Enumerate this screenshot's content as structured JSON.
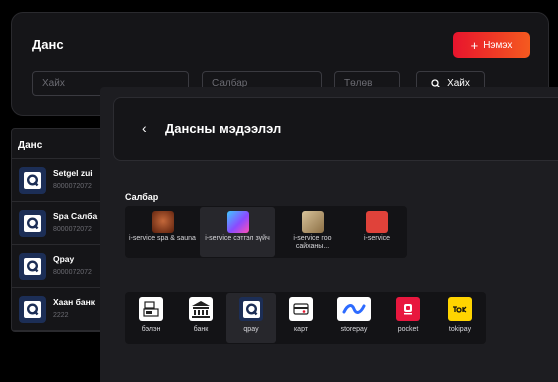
{
  "page": {
    "title": "Данс",
    "add_button": "Нэмэх",
    "search": {
      "placeholder": "Хайх"
    },
    "branch_select": {
      "placeholder": "Салбар"
    },
    "bank_select": {
      "placeholder": "Төлөв"
    },
    "search_button": "Хайх"
  },
  "table": {
    "header": "Данс",
    "rows": [
      {
        "name": "Setgel zui",
        "account": "8000072072"
      },
      {
        "name": "Spa Салба",
        "account": "8000072072"
      },
      {
        "name": "Qpay",
        "account": "8000072072"
      },
      {
        "name": "Хаан банк",
        "account": "2222"
      }
    ]
  },
  "drawer": {
    "title": "Дансны мэдээлэл",
    "branch_label": "Салбар",
    "branches": [
      {
        "label": "i-service spa & sauna",
        "selected": false,
        "color": "#6b2a10"
      },
      {
        "label": "i-service сэтгэл зүйч",
        "selected": true,
        "color": "#7a5cff"
      },
      {
        "label": "i-service гоо сайханы...",
        "selected": false,
        "color": "#b89a6a"
      },
      {
        "label": "i-service",
        "selected": false,
        "color": "#e0423a"
      }
    ],
    "payments": [
      {
        "label": "бэлэн",
        "icon": "cash-register-icon",
        "selected": false
      },
      {
        "label": "банк",
        "icon": "bank-icon",
        "selected": false
      },
      {
        "label": "qpay",
        "icon": "qpay-icon",
        "selected": true
      },
      {
        "label": "карт",
        "icon": "card-icon",
        "selected": false
      },
      {
        "label": "storepay",
        "icon": "storepay-icon",
        "selected": false
      },
      {
        "label": "pocket",
        "icon": "pocket-icon",
        "selected": false
      },
      {
        "label": "tokipay",
        "icon": "tokipay-icon",
        "selected": false
      }
    ]
  },
  "colors": {
    "accent_start": "#e8142d",
    "accent_end": "#f55a1f",
    "qpay_blue": "#1c2e56",
    "storepay_blue": "#2d6bff",
    "pocket_red": "#e8173e",
    "toki_yellow": "#ffd400"
  }
}
